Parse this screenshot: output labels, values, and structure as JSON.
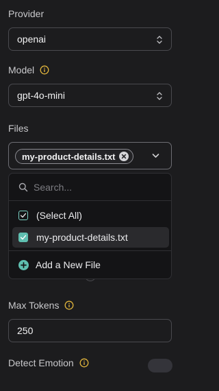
{
  "provider": {
    "label": "Provider",
    "value": "openai"
  },
  "model": {
    "label": "Model",
    "value": "gpt-4o-mini"
  },
  "files": {
    "label": "Files",
    "selected_chip": "my-product-details.txt",
    "dropdown": {
      "search_placeholder": "Search...",
      "options": [
        {
          "label": "(Select All)",
          "checked": true
        },
        {
          "label": "my-product-details.txt",
          "checked": true
        }
      ],
      "add_label": "Add a New File"
    }
  },
  "max_tokens": {
    "label": "Max Tokens",
    "value": "250"
  },
  "detect_emotion": {
    "label": "Detect Emotion",
    "enabled": false
  },
  "colors": {
    "accent": "#5fbfb0",
    "info": "#e0b43c",
    "background": "#1c1c1e"
  }
}
